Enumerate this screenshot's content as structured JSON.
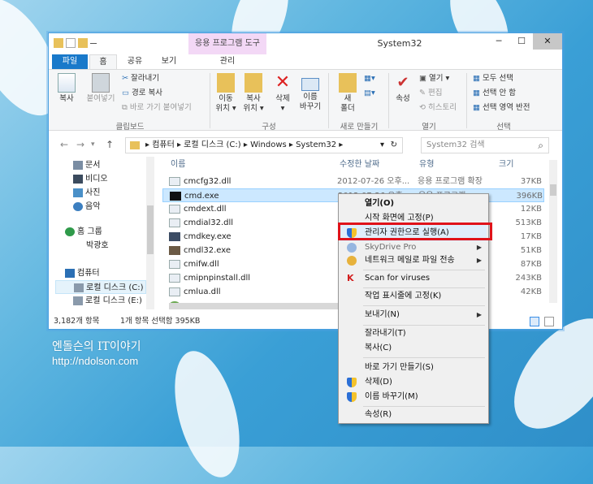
{
  "window": {
    "title": "System32",
    "minimize": "─",
    "maximize": "☐",
    "close": "✕"
  },
  "ribbon": {
    "context_tab_title": "응용 프로그램 도구",
    "tabs": [
      "파일",
      "홈",
      "공유",
      "보기",
      "관리"
    ],
    "clipboard": {
      "copy": "복사",
      "paste": "붙여넣기",
      "cut": "잘라내기",
      "copy_path": "경로 복사",
      "paste_shortcut": "바로 가기 붙여넣기",
      "label": "클립보드"
    },
    "organize": {
      "move_to": [
        "이동",
        "위치 ▾"
      ],
      "copy_to": [
        "복사",
        "위치 ▾"
      ],
      "delete": [
        "삭제",
        "▾"
      ],
      "rename": [
        "이름",
        "바꾸기"
      ],
      "label": "구성"
    },
    "new": {
      "new_folder": [
        "새",
        "폴더"
      ],
      "label": "새로 만들기"
    },
    "open": {
      "properties": "속성",
      "open": "열기 ▾",
      "edit": "편집",
      "history": "히스토리",
      "label": "열기"
    },
    "select": {
      "select_all": "모두 선택",
      "select_none": "선택 안 함",
      "invert": "선택 영역 반전",
      "label": "선택"
    }
  },
  "address": {
    "back": "←",
    "forward": "→",
    "up_dropdown": "▾",
    "up": "↑",
    "path": "▸ 컴퓨터 ▸ 로컬 디스크 (C:) ▸ Windows ▸ System32 ▸",
    "refresh": "↻",
    "dropdown": "▾",
    "search_placeholder": "System32 검색",
    "search_icon": "⌕"
  },
  "nav_pane": {
    "items": [
      {
        "label": "문서",
        "icon": "documents-icon"
      },
      {
        "label": "비디오",
        "icon": "videos-icon"
      },
      {
        "label": "사진",
        "icon": "pictures-icon"
      },
      {
        "label": "음악",
        "icon": "music-icon"
      },
      {
        "label": "홈 그룹",
        "icon": "homegroup-icon"
      },
      {
        "label": "박광호",
        "icon": ""
      },
      {
        "label": "컴퓨터",
        "icon": "computer-icon"
      },
      {
        "label": "로컬 디스크 (C:)",
        "icon": "drive-icon"
      },
      {
        "label": "로컬 디스크 (E:)",
        "icon": "drive-icon"
      },
      {
        "label": "",
        "icon": ""
      }
    ]
  },
  "file_list": {
    "columns": [
      "이름",
      "수정한 날짜",
      "유형",
      "크기"
    ],
    "rows": [
      {
        "name": "cmcfg32.dll",
        "date": "2012-07-26 오후...",
        "type": "응용 프로그램 확장",
        "size": "37KB"
      },
      {
        "name": "cmd.exe",
        "date": "2012-07-26 오후...",
        "type": "응용 프로그램",
        "size": "396KB"
      },
      {
        "name": "cmdext.dll",
        "date": "",
        "type": "",
        "size": "12KB"
      },
      {
        "name": "cmdial32.dll",
        "date": "",
        "type": "",
        "size": "513KB"
      },
      {
        "name": "cmdkey.exe",
        "date": "",
        "type": "",
        "size": "17KB"
      },
      {
        "name": "cmdl32.exe",
        "date": "",
        "type": "",
        "size": "51KB"
      },
      {
        "name": "cmifw.dll",
        "date": "",
        "type": "",
        "size": "87KB"
      },
      {
        "name": "cmipnpinstall.dll",
        "date": "",
        "type": "",
        "size": "243KB"
      },
      {
        "name": "cmlua.dll",
        "date": "",
        "type": "",
        "size": "42KB"
      },
      {
        "name": "",
        "date": "",
        "type": "",
        "size": ""
      }
    ]
  },
  "status": {
    "count": "3,182개 항목",
    "selected": "1개 항목 선택함 395KB"
  },
  "context_menu": {
    "open": "열기(O)",
    "pin_start": "시작 화면에 고정(P)",
    "run_as_admin": "관리자 권한으로 실행(A)",
    "skydrive": "SkyDrive Pro",
    "send_network": "네트워크 메일로 파일 전송",
    "scan": "Scan for viruses",
    "pin_taskbar": "작업 표시줄에 고정(K)",
    "send_to": "보내기(N)",
    "cut": "잘라내기(T)",
    "copy": "복사(C)",
    "create_shortcut": "바로 가기 만들기(S)",
    "delete": "삭제(D)",
    "rename": "이름 바꾸기(M)",
    "properties": "속성(R)",
    "submenu_arrow": "▶"
  },
  "watermark": {
    "line1": "엔돌슨의 IT이야기",
    "line2": "http://ndolson.com"
  },
  "colors": {
    "file_tab": "#1979ca",
    "context_tab": "#f3d8f6",
    "selection": "#cce8ff",
    "highlight_box": "#e0131a",
    "desktop": "#3a9fd6"
  }
}
